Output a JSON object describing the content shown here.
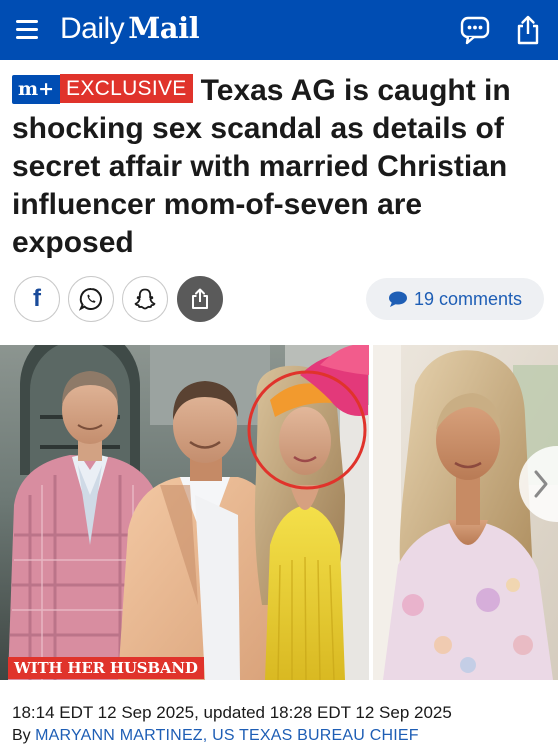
{
  "header": {
    "logo_daily": "Daily",
    "logo_mail": "Mail",
    "brand_color": "#004DB3",
    "icons": [
      "menu-icon",
      "chat-bubble-icon",
      "share-icon"
    ]
  },
  "article": {
    "badge_plus": "m+",
    "badge_exclusive": "EXCLUSIVE",
    "headline": "Texas AG is caught in shocking sex scandal as details of secret affair with married Christian influencer mom-of-seven are exposed",
    "accent_color": "#E0332B"
  },
  "share_bar": {
    "facebook_glyph": "f",
    "icons": [
      "facebook-icon",
      "whatsapp-icon",
      "snapchat-icon",
      "share-icon"
    ],
    "comments_label": "19 comments"
  },
  "gallery": {
    "caption": "WITH HER HUSBAND"
  },
  "meta": {
    "timestamp": "18:14 EDT 12 Sep 2025, updated 18:28 EDT 12 Sep 2025",
    "byline_prefix": "By",
    "author": "MARYANN MARTINEZ, US TEXAS BUREAU CHIEF"
  }
}
